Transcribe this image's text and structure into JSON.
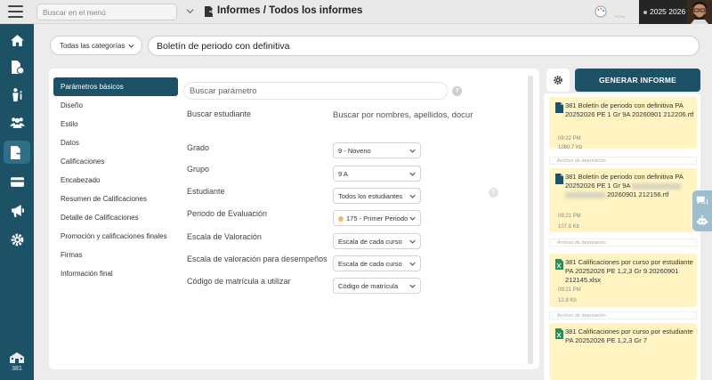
{
  "topbar": {
    "search_placeholder": "Buscar en el menú",
    "breadcrumb": "Informes / Todos los informes",
    "mini_text": "TUTHI",
    "year": "2025 2026"
  },
  "sidebar": {
    "bottom_label": "381"
  },
  "category": {
    "selected": "Todas las categorías",
    "report_title": "Boletín de periodo con definitiva"
  },
  "tabs": [
    "Parámetros básicos",
    "Diseño",
    "Estilo",
    "Datos",
    "Calificaciones",
    "Encabezado",
    "Resumen de Calificaciones",
    "Detalle de Calificaciones",
    "Promoción y calificaciones finales",
    "Firmas",
    "Información final"
  ],
  "params": {
    "search_placeholder": "Buscar parámetro",
    "student_search_label": "Buscar estudiante",
    "student_search_placeholder": "Buscar por nombres, apellidos, docur",
    "fields": [
      {
        "label": "Grado",
        "value": "9 - Noveno"
      },
      {
        "label": "Grupo",
        "value": "9 A"
      },
      {
        "label": "Estudiante",
        "value": "Todos los estudiantes"
      },
      {
        "label": "Periodo de Evaluación",
        "value": "175 - Primer Periodo"
      },
      {
        "label": "Escala de Valoración",
        "value": "Escala de cada curso"
      },
      {
        "label": "Escala de valoración para desempeños",
        "value": "Escala de cada curso"
      },
      {
        "label": "Código de matrícula a utilizar",
        "value": "Código de matrícula"
      }
    ],
    "help_glyph": "?"
  },
  "generate_label": "GENERAR INFORME",
  "files": [
    {
      "name": "381 Boletín de periodo con definitiva PA 20252026 PE 1 Gr 9A 20260901 212206.rtf",
      "time": "09:22 PM",
      "size": "1060.7 Kb",
      "note": "Archivo de depuración"
    },
    {
      "name_a": "381 Boletín de periodo con definitiva PA 20252026 PE 1 Gr 9A",
      "name_b": "20260901 212156.rtf",
      "time": "09:21 PM",
      "size": "107.8 Kb",
      "note": "Archivo de depuración"
    },
    {
      "name": "381 Calificaciones por curso por estudiante PA 20252026 PE 1,2,3 Gr 9 20260901 212145.xlsx",
      "time": "09:21 PM",
      "size": "12.8 Kb",
      "note": "Archivo de depuración"
    },
    {
      "name": "381 Calificaciones por curso por estudiante PA 20252026 PE 1,2,3 Gr 7"
    }
  ],
  "colors": {
    "sidebar": "#1d5166",
    "accent": "#1d5166",
    "file_card": "#fff4c2",
    "pdf_icon": "#1d5166",
    "xlsx_icon": "#2e8b57"
  }
}
